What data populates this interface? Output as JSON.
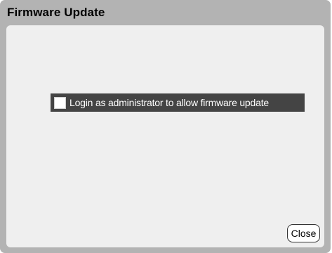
{
  "window": {
    "title": "Firmware Update"
  },
  "login": {
    "label": "Login as administrator to allow firmware update",
    "checked": false
  },
  "actions": {
    "close_label": "Close"
  },
  "colors": {
    "frame": "#b3b3b3",
    "panel": "#efefef",
    "highlight": "#444444"
  }
}
